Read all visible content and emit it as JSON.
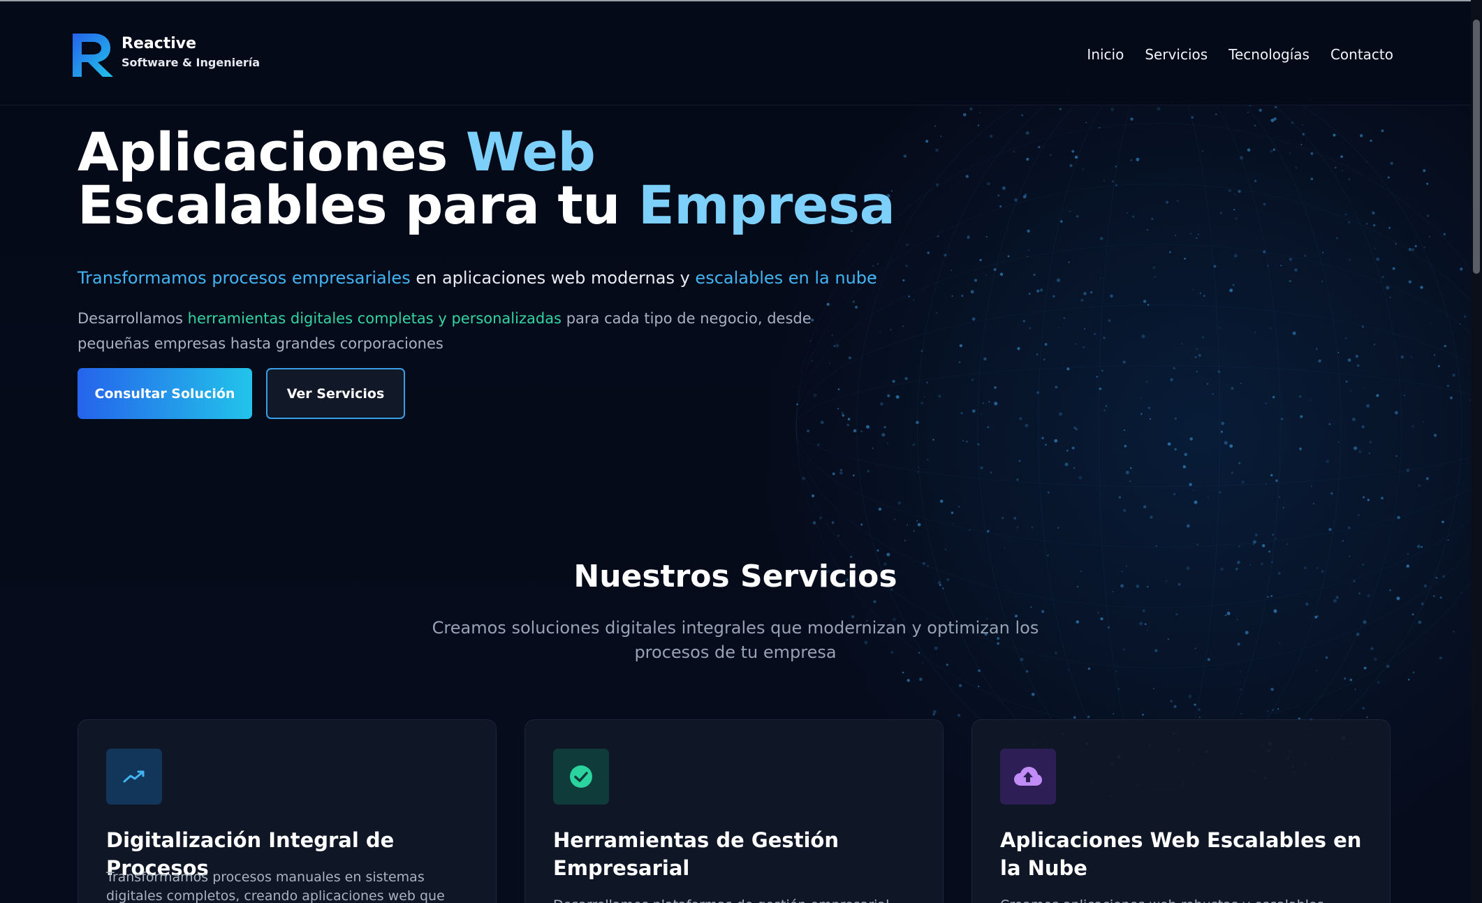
{
  "brand": {
    "name": "Reactive",
    "tagline": "Software & Ingeniería"
  },
  "nav": {
    "items": [
      {
        "label": "Inicio"
      },
      {
        "label": "Servicios"
      },
      {
        "label": "Tecnologías"
      },
      {
        "label": "Contacto"
      }
    ]
  },
  "hero": {
    "title_line1_part1": "Aplicaciones ",
    "title_line1_part2": "Web",
    "title_line2_part1": "Escalables para tu ",
    "title_line2_part2": "Empresa",
    "subtitle_hl1": "Transformamos procesos empresariales",
    "subtitle_mid": " en aplicaciones web modernas y ",
    "subtitle_hl2": "escalables en la nube",
    "desc_part1": "Desarrollamos ",
    "desc_hl": "herramientas digitales completas y personalizadas",
    "desc_part2": " para cada tipo de negocio, desde pequeñas empresas hasta grandes corporaciones",
    "primary_button": "Consultar Solución",
    "secondary_button": "Ver Servicios"
  },
  "services": {
    "title": "Nuestros Servicios",
    "subtitle": "Creamos soluciones digitales integrales que modernizan y optimizan los procesos de tu empresa",
    "cards": [
      {
        "icon": "trending-up-icon",
        "title": "Digitalización Integral de Procesos",
        "description": "Transformamos procesos manuales en sistemas digitales completos, creando aplicaciones web que automatizan y"
      },
      {
        "icon": "check-circle-icon",
        "title": "Herramientas de Gestión Empresarial",
        "description": "Desarrollamos plataformas de gestión empresarial"
      },
      {
        "icon": "cloud-upload-icon",
        "title": "Aplicaciones Web Escalables en la Nube",
        "description": "Creamos aplicaciones web robustas y escalables"
      }
    ]
  },
  "colors": {
    "background": "#050a18",
    "accent_light_blue": "#7dd0fa",
    "accent_blue": "#43b4f3",
    "accent_green": "#34d3a2",
    "button_gradient_start": "#2563eb",
    "button_gradient_end": "#22c4ea"
  }
}
